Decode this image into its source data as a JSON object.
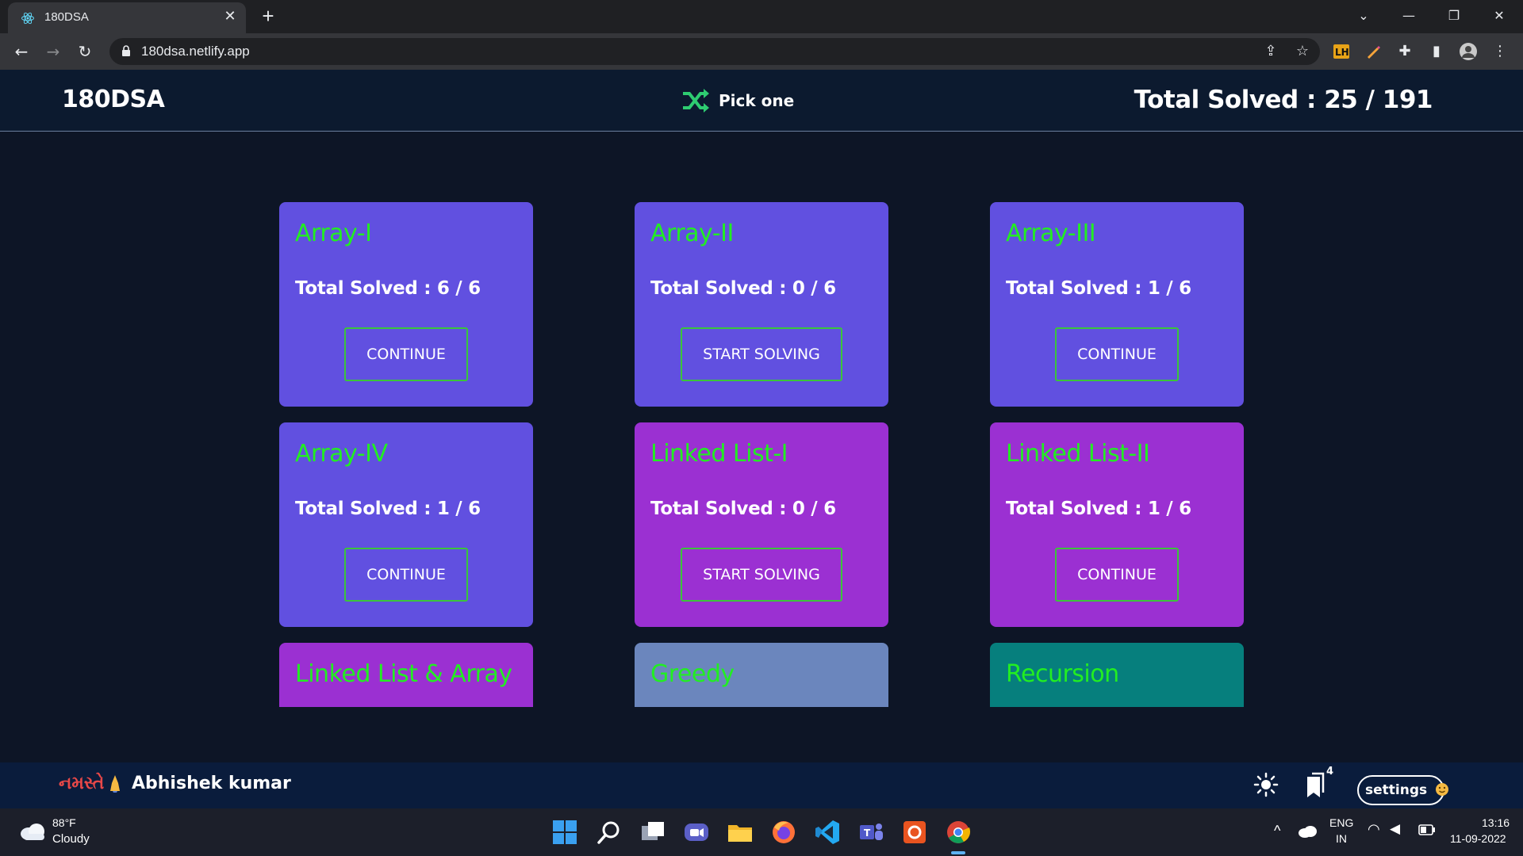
{
  "browser": {
    "tab_title": "180DSA",
    "url": "180dsa.netlify.app"
  },
  "header": {
    "brand": "180DSA",
    "pick_one": "Pick one",
    "total_solved": "Total Solved : 25 / 191"
  },
  "cards": [
    {
      "title": "Array-I",
      "solved": "Total Solved : 6 / 6",
      "button": "CONTINUE",
      "color": "#6150e0"
    },
    {
      "title": "Array-II",
      "solved": "Total Solved : 0 / 6",
      "button": "START SOLVING",
      "color": "#6150e0"
    },
    {
      "title": "Array-III",
      "solved": "Total Solved : 1 / 6",
      "button": "CONTINUE",
      "color": "#6150e0"
    },
    {
      "title": "Array-IV",
      "solved": "Total Solved : 1 / 6",
      "button": "CONTINUE",
      "color": "#6150e0"
    },
    {
      "title": "Linked List-I",
      "solved": "Total Solved : 0 / 6",
      "button": "START SOLVING",
      "color": "#9b30d2"
    },
    {
      "title": "Linked List-II",
      "solved": "Total Solved : 1 / 6",
      "button": "CONTINUE",
      "color": "#9b30d2"
    },
    {
      "title": "Linked List & Array",
      "color": "#9b30d2"
    },
    {
      "title": "Greedy",
      "color": "#6b86bd"
    },
    {
      "title": "Recursion",
      "color": "#067f7d"
    }
  ],
  "footer": {
    "greeting": "નમસ્તે",
    "name": "Abhishek kumar",
    "bookmark_count": "4",
    "settings_label": "settings"
  },
  "taskbar": {
    "temperature": "88°F",
    "weather": "Cloudy",
    "lang_top": "ENG",
    "lang_bottom": "IN",
    "time": "13:16",
    "date": "11-09-2022"
  },
  "colors": {
    "accent_green": "#22ee22",
    "page_bg": "#0d1526",
    "header_bg": "#0c1a2f",
    "footer_bg": "#0a1c3c"
  }
}
